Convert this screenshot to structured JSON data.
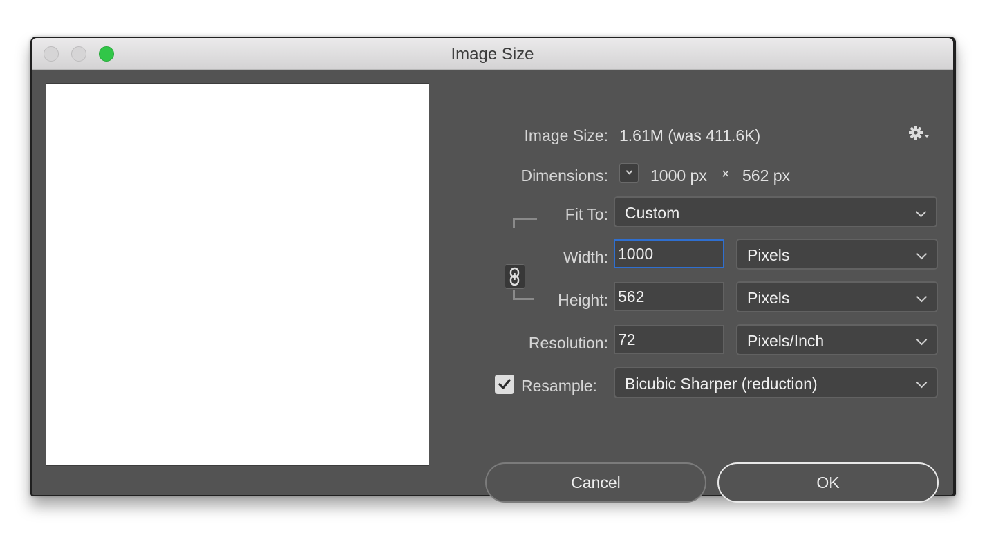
{
  "window": {
    "title": "Image Size",
    "traffic_lights": [
      "close",
      "minimize",
      "zoom"
    ]
  },
  "info": {
    "image_size_label": "Image Size:",
    "image_size_value": "1.61M (was 411.6K)",
    "settings_icon": "gear-icon",
    "dimensions_label": "Dimensions:",
    "dimensions_width": "1000 px",
    "dimensions_times": "×",
    "dimensions_height": "562 px"
  },
  "fit_to": {
    "label": "Fit To:",
    "value": "Custom"
  },
  "width": {
    "label": "Width:",
    "value": "1000",
    "unit": "Pixels"
  },
  "height": {
    "label": "Height:",
    "value": "562",
    "unit": "Pixels"
  },
  "resolution": {
    "label": "Resolution:",
    "value": "72",
    "unit": "Pixels/Inch"
  },
  "resample": {
    "label": "Resample:",
    "checked": true,
    "value": "Bicubic Sharper (reduction)"
  },
  "constrain_icon": "link-icon",
  "buttons": {
    "cancel": "Cancel",
    "ok": "OK"
  }
}
